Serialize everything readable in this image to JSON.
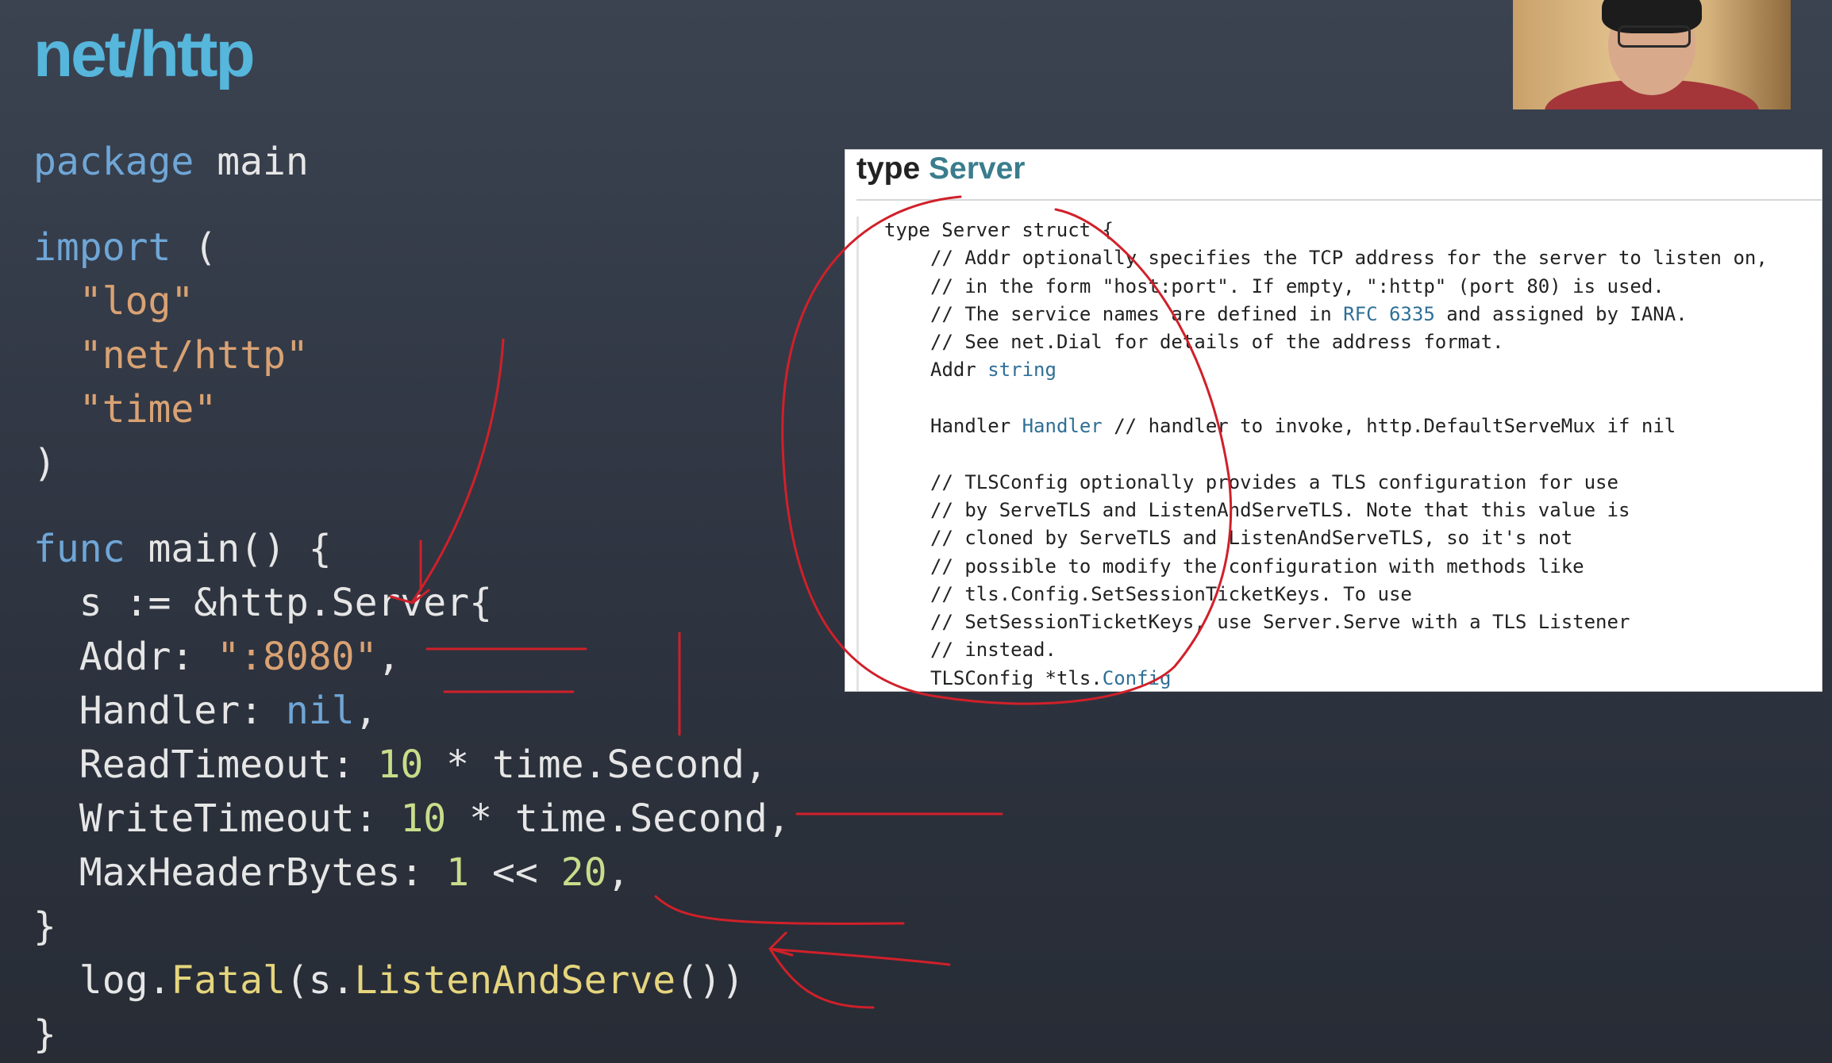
{
  "slide": {
    "title": "net/http",
    "code": {
      "package_kw": "package",
      "package_name": " main",
      "import_kw": "import",
      "import_open": " (",
      "imports": [
        "\"log\"",
        "\"net/http\"",
        "\"time\""
      ],
      "import_close": ")",
      "func_kw": "func",
      "func_sig": " main() {",
      "server_line": "  s := &http.Server{",
      "addr_key": "  Addr: ",
      "addr_val": "\":8080\"",
      "handler_key": "  Handler: ",
      "handler_val": "nil",
      "read_key": "  ReadTimeout: ",
      "read_num": "10",
      "read_rest": " * time.Second,",
      "write_key": "  WriteTimeout: ",
      "write_num": "10",
      "write_rest": " * time.Second,",
      "maxh_key": "  MaxHeaderBytes: ",
      "maxh_num1": "1",
      "maxh_op": " << ",
      "maxh_num2": "20",
      "brace_close": "}",
      "log_pre": "  log.",
      "log_fn": "Fatal",
      "log_mid": "(s.",
      "log_fn2": "ListenAndServe",
      "log_end": "())",
      "func_close": "}"
    }
  },
  "doc": {
    "header_kw": "type",
    "header_name": "Server",
    "struct_open": "type Server struct {",
    "addr_comments": [
      "// Addr optionally specifies the TCP address for the server to listen on,",
      "// in the form \"host:port\". If empty, \":http\" (port 80) is used."
    ],
    "rfc_pre": "// The service names are defined in ",
    "rfc_link": "RFC 6335",
    "rfc_post": " and assigned by IANA.",
    "dial_comment": "// See net.Dial for details of the address format.",
    "addr_field": "Addr",
    "addr_type": "string",
    "handler_field": "Handler",
    "handler_type": "Handler",
    "handler_comment": "// handler to invoke, http.DefaultServeMux if nil",
    "tls_comments": [
      "// TLSConfig optionally provides a TLS configuration for use",
      "// by ServeTLS and ListenAndServeTLS. Note that this value is",
      "// cloned by ServeTLS and ListenAndServeTLS, so it's not",
      "// possible to modify the configuration with methods like",
      "// tls.Config.SetSessionTicketKeys. To use",
      "// SetSessionTicketKeys, use Server.Serve with a TLS Listener",
      "// instead."
    ],
    "tls_field": "TLSConfig",
    "tls_type_pre": "*tls.",
    "tls_type": "Config"
  },
  "colors": {
    "title": "#56b6dc",
    "annotation": "#d0202a",
    "keyword": "#6fa6d6",
    "string": "#d9a273",
    "number": "#c9dc8a"
  }
}
